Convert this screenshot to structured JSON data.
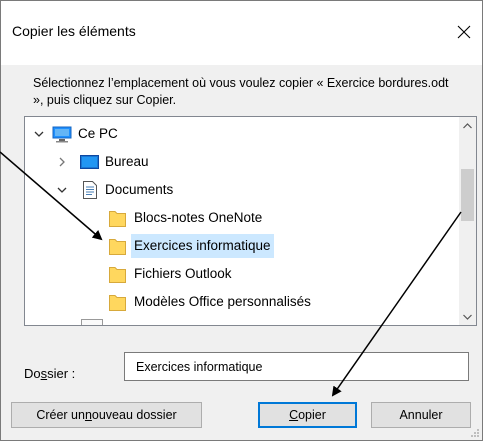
{
  "dialog": {
    "title": "Copier les éléments",
    "instruction": "Sélectionnez l’emplacement où vous voulez copier « Exercice bordures.odt », puis cliquez sur Copier."
  },
  "tree": {
    "items": [
      {
        "label": "Ce PC",
        "icon": "computer-icon",
        "expander": "expanded"
      },
      {
        "label": "Bureau",
        "icon": "desktop-icon",
        "expander": "collapsed"
      },
      {
        "label": "Documents",
        "icon": "documents-icon",
        "expander": "expanded"
      },
      {
        "label": "Blocs-notes OneNote",
        "icon": "folder-icon"
      },
      {
        "label": "Exercices informatique",
        "icon": "folder-icon",
        "selected": true
      },
      {
        "label": "Fichiers Outlook",
        "icon": "folder-icon"
      },
      {
        "label": "Modèles Office personnalisés",
        "icon": "folder-icon"
      }
    ]
  },
  "folder": {
    "label_pre": "Do",
    "label_ul": "s",
    "label_post": "sier :",
    "value": "Exercices informatique"
  },
  "buttons": {
    "new_folder_pre": "Créer un ",
    "new_folder_ul": "n",
    "new_folder_post": "ouveau dossier",
    "copy_ul": "C",
    "copy_post": "opier",
    "cancel": "Annuler"
  },
  "colors": {
    "selection": "#cce8ff",
    "default_button_border": "#0078d7",
    "folder_yellow": "#ffd75e"
  }
}
